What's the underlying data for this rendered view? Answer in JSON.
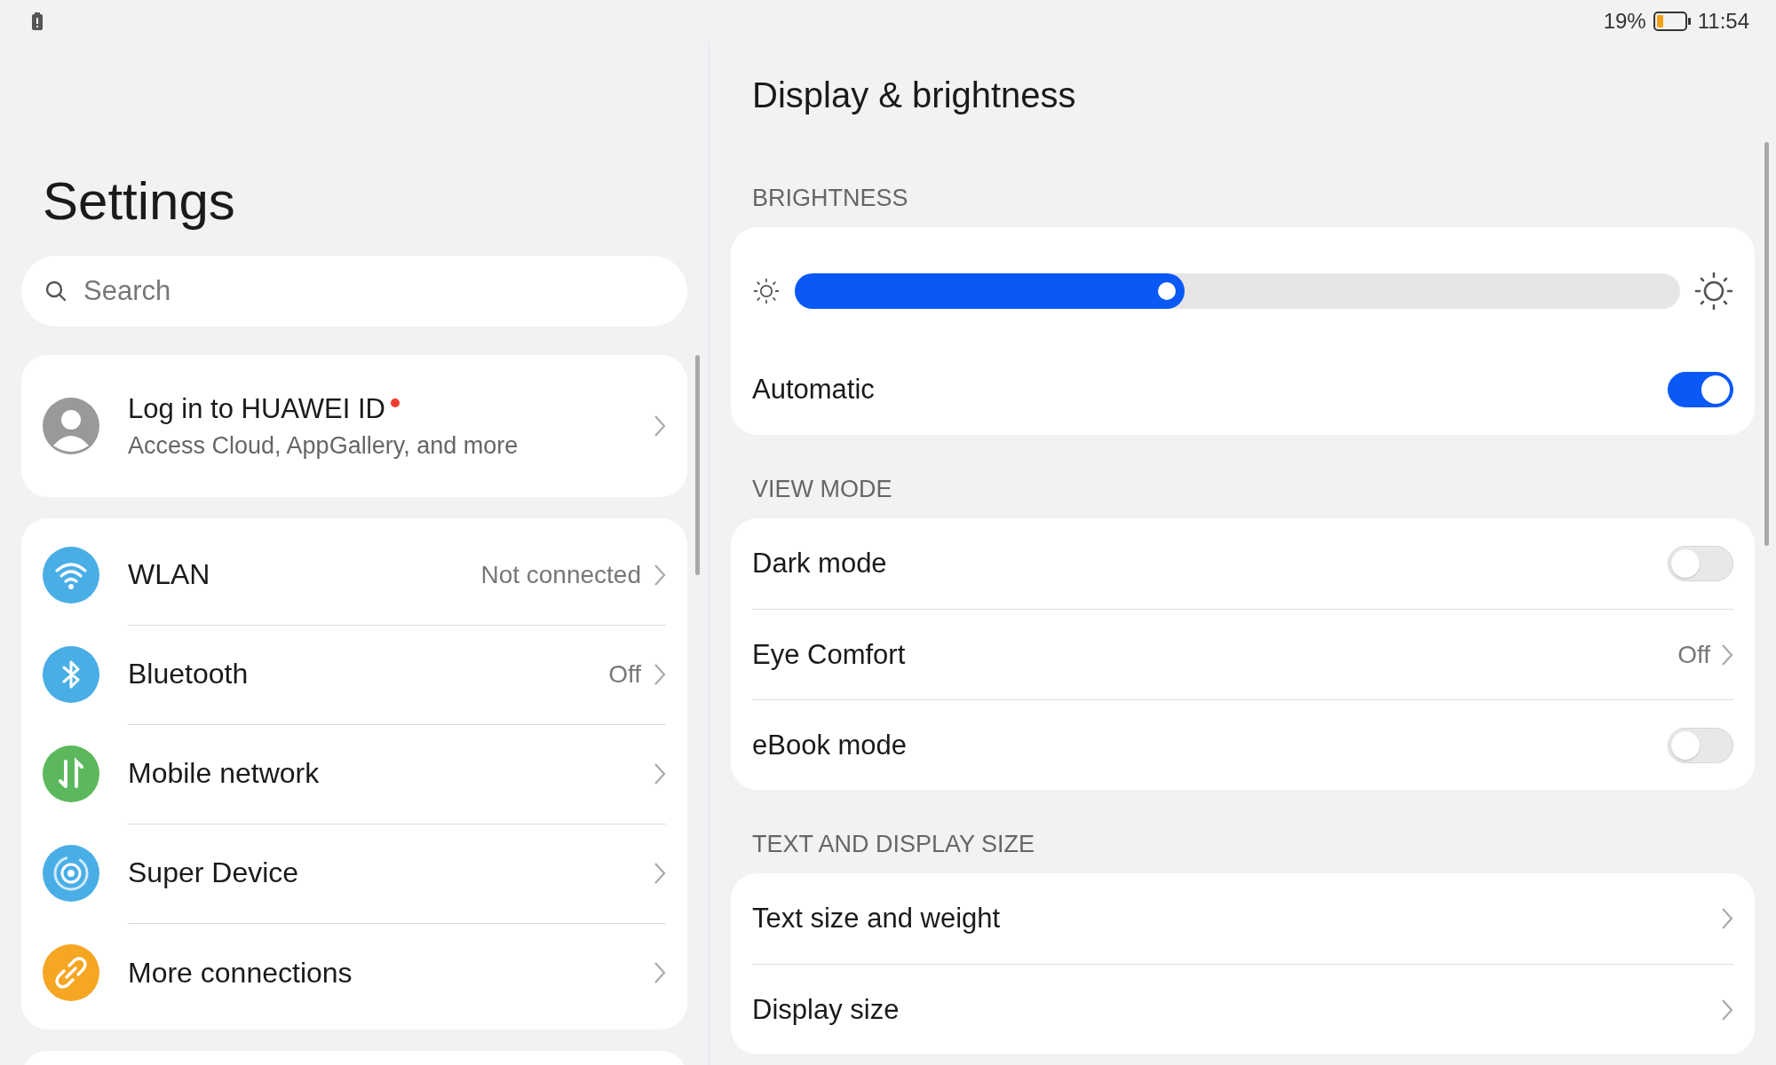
{
  "status_bar": {
    "battery_percent": "19%",
    "time": "11:54"
  },
  "settings": {
    "title": "Settings",
    "search": {
      "placeholder": "Search"
    },
    "account": {
      "title": "Log in to HUAWEI ID",
      "subtitle": "Access Cloud, AppGallery, and more",
      "notification": true
    },
    "items": [
      {
        "kind": "wifi",
        "color": "#4aaee6",
        "label": "WLAN",
        "value": "Not connected"
      },
      {
        "kind": "bluetooth",
        "color": "#4aaee6",
        "label": "Bluetooth",
        "value": "Off"
      },
      {
        "kind": "mobile",
        "color": "#5cb85c",
        "label": "Mobile network"
      },
      {
        "kind": "super-device",
        "color": "#4aaee6",
        "label": "Super Device"
      },
      {
        "kind": "link",
        "color": "#f5a623",
        "label": "More connections"
      }
    ]
  },
  "detail": {
    "title": "Display & brightness",
    "sections": [
      {
        "heading": "BRIGHTNESS",
        "rows": [
          {
            "kind": "slider",
            "level": 0.44
          },
          {
            "kind": "toggle",
            "label": "Automatic",
            "on": true
          }
        ]
      },
      {
        "heading": "VIEW MODE",
        "rows": [
          {
            "kind": "toggle",
            "label": "Dark mode",
            "on": false
          },
          {
            "kind": "link",
            "label": "Eye Comfort",
            "value": "Off"
          },
          {
            "kind": "toggle",
            "label": "eBook mode",
            "on": false
          }
        ]
      },
      {
        "heading": "TEXT AND DISPLAY SIZE",
        "rows": [
          {
            "kind": "link",
            "label": "Text size and weight"
          },
          {
            "kind": "link",
            "label": "Display size"
          }
        ]
      }
    ]
  }
}
